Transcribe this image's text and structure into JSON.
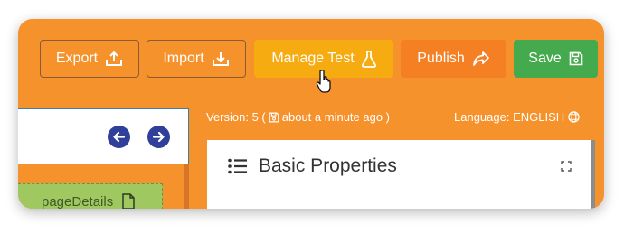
{
  "toolbar": {
    "export_label": "Export",
    "import_label": "Import",
    "manage_test_label": "Manage Test",
    "publish_label": "Publish",
    "save_label": "Save"
  },
  "nodes": {
    "item_label": "pageDetails"
  },
  "meta": {
    "version_prefix": "Version: 5 (",
    "version_time": "about a minute ago )",
    "language_label": "Language: ENGLISH"
  },
  "panel": {
    "title": "Basic Properties"
  },
  "colors": {
    "background": "#f5922c",
    "manage_test": "#f6ab11",
    "publish": "#f57f23",
    "save": "#45aa4e",
    "nav_button": "#2f3f9a",
    "node": "#9fc960"
  },
  "icons": [
    "export-icon",
    "import-icon",
    "flask-icon",
    "share-icon",
    "save-icon",
    "hand-cursor-icon",
    "arrow-left-icon",
    "arrow-right-icon",
    "file-icon",
    "floppy-icon",
    "globe-icon",
    "list-icon",
    "expand-icon"
  ]
}
